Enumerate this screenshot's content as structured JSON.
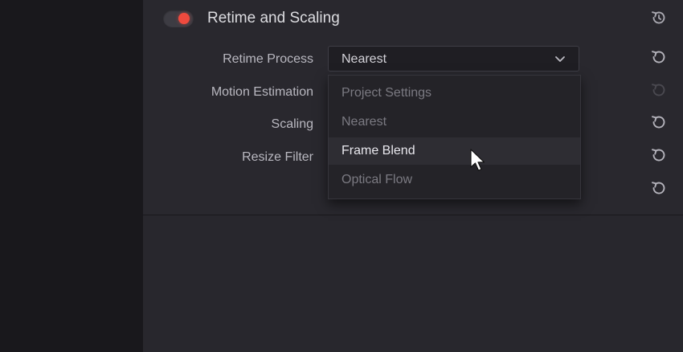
{
  "section": {
    "title": "Retime and Scaling",
    "enabled": true,
    "accent_color": "#ef4a3e"
  },
  "rows": [
    {
      "label": "Retime Process"
    },
    {
      "label": "Motion Estimation"
    },
    {
      "label": "Scaling"
    },
    {
      "label": "Resize Filter"
    }
  ],
  "retime_select": {
    "value": "Nearest",
    "options": [
      {
        "label": "Project Settings",
        "state": "dim"
      },
      {
        "label": "Nearest",
        "state": "dim"
      },
      {
        "label": "Frame Blend",
        "state": "hover"
      },
      {
        "label": "Optical Flow",
        "state": "dim"
      }
    ]
  },
  "icons": {
    "reset": "reset-icon",
    "chevron": "chevron-down-icon",
    "cursor": "mouse-pointer-icon"
  }
}
